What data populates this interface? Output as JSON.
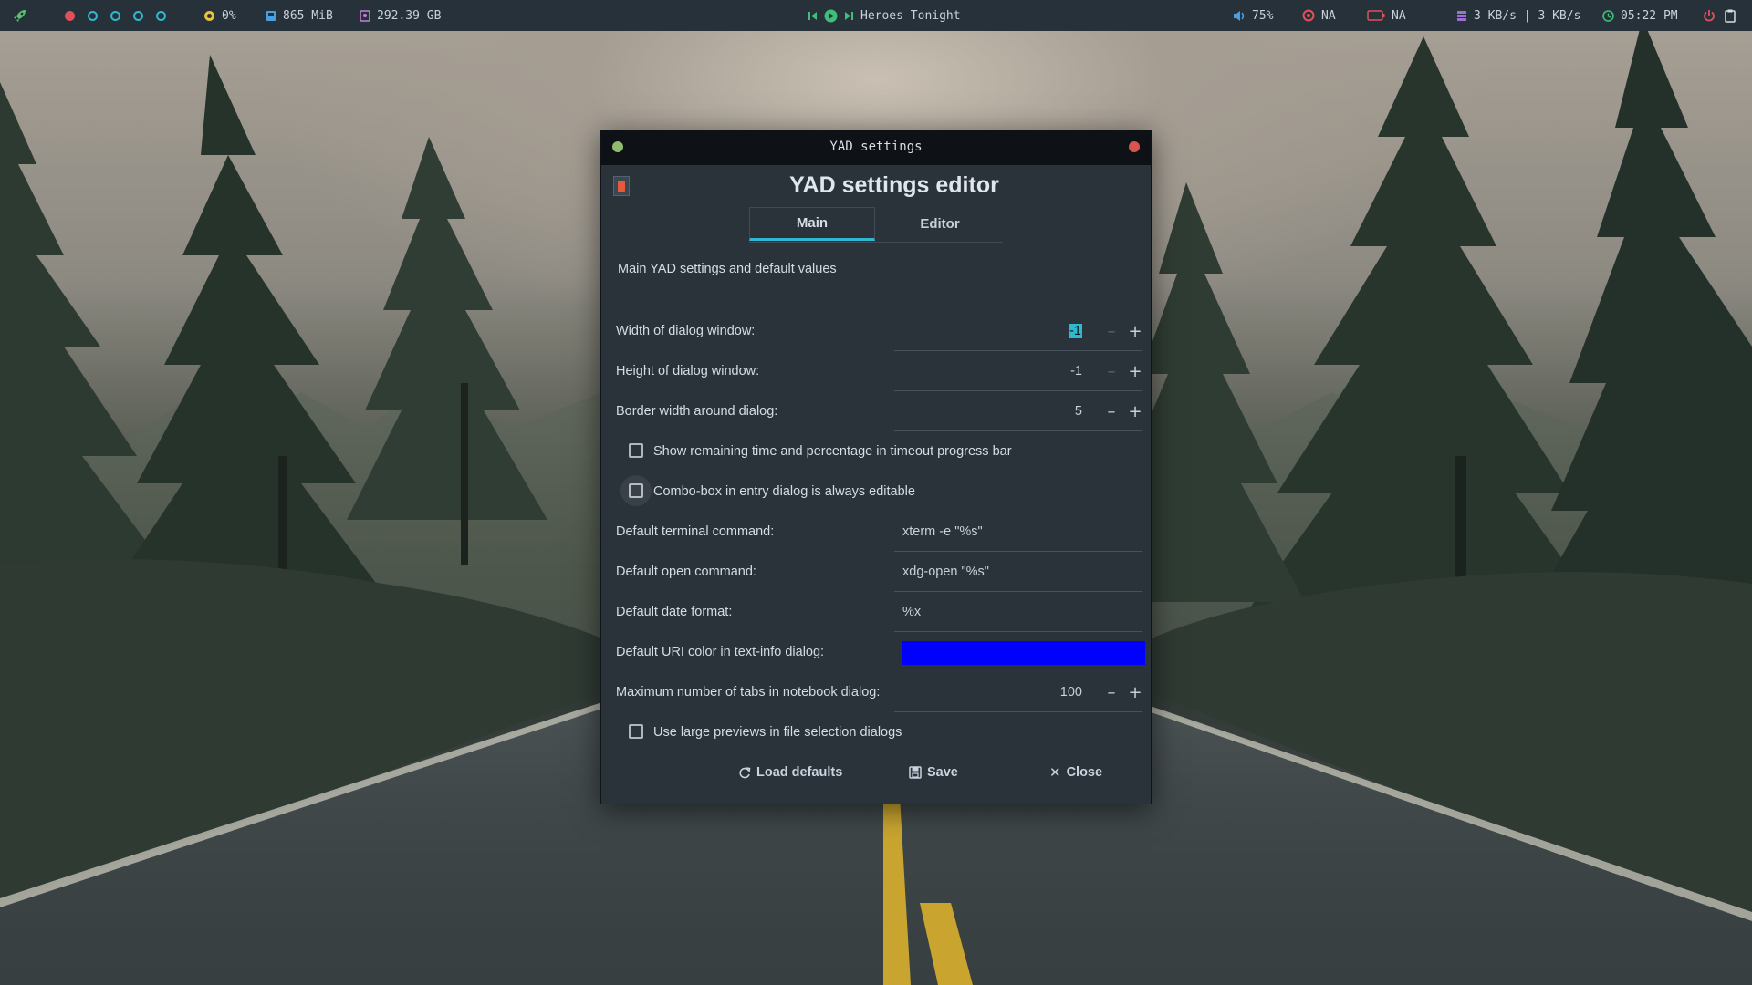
{
  "colors": {
    "accent": "#2fb9d0",
    "uri_color": "#0000ff",
    "close_dot": "#d9534f",
    "min_dot": "#8fbc6f"
  },
  "topbar": {
    "launcher_icon": "rocket-icon",
    "workspaces": 5,
    "cpu": "0%",
    "memory": "865 MiB",
    "disk": "292.39 GB",
    "media": {
      "track": "Heroes Tonight",
      "prev_icon": "skip-back-icon",
      "play_icon": "play-icon",
      "next_icon": "skip-forward-icon"
    },
    "volume": "75%",
    "brightness": "NA",
    "battery": "NA",
    "network": "3 KB/s | 3 KB/s",
    "clock": "05:22 PM"
  },
  "window": {
    "title": "YAD settings",
    "heading": "YAD settings editor",
    "tabs": [
      "Main",
      "Editor"
    ],
    "active_tab": "Main",
    "description": "Main YAD settings and default values",
    "fields": {
      "width_label": "Width of dialog window:",
      "width_value": "-1",
      "height_label": "Height of dialog window:",
      "height_value": "-1",
      "border_label": "Border width around dialog:",
      "border_value": "5",
      "show_time_label": "Show remaining time and percentage in timeout progress bar",
      "show_time_checked": false,
      "combo_label": "Combo-box in entry dialog is always editable",
      "combo_checked": false,
      "terminal_label": "Default terminal command:",
      "terminal_value": "xterm -e \"%s\"",
      "open_label": "Default open command:",
      "open_value": "xdg-open \"%s\"",
      "date_label": "Default date format:",
      "date_value": "%x",
      "uri_label": "Default URI color in text-info dialog:",
      "max_tabs_label": "Maximum number of tabs in notebook dialog:",
      "max_tabs_value": "100",
      "large_previews_label": "Use large previews in file selection dialogs",
      "large_previews_checked": false
    },
    "buttons": {
      "load_defaults": "Load defaults",
      "save": "Save",
      "close": "Close"
    }
  }
}
